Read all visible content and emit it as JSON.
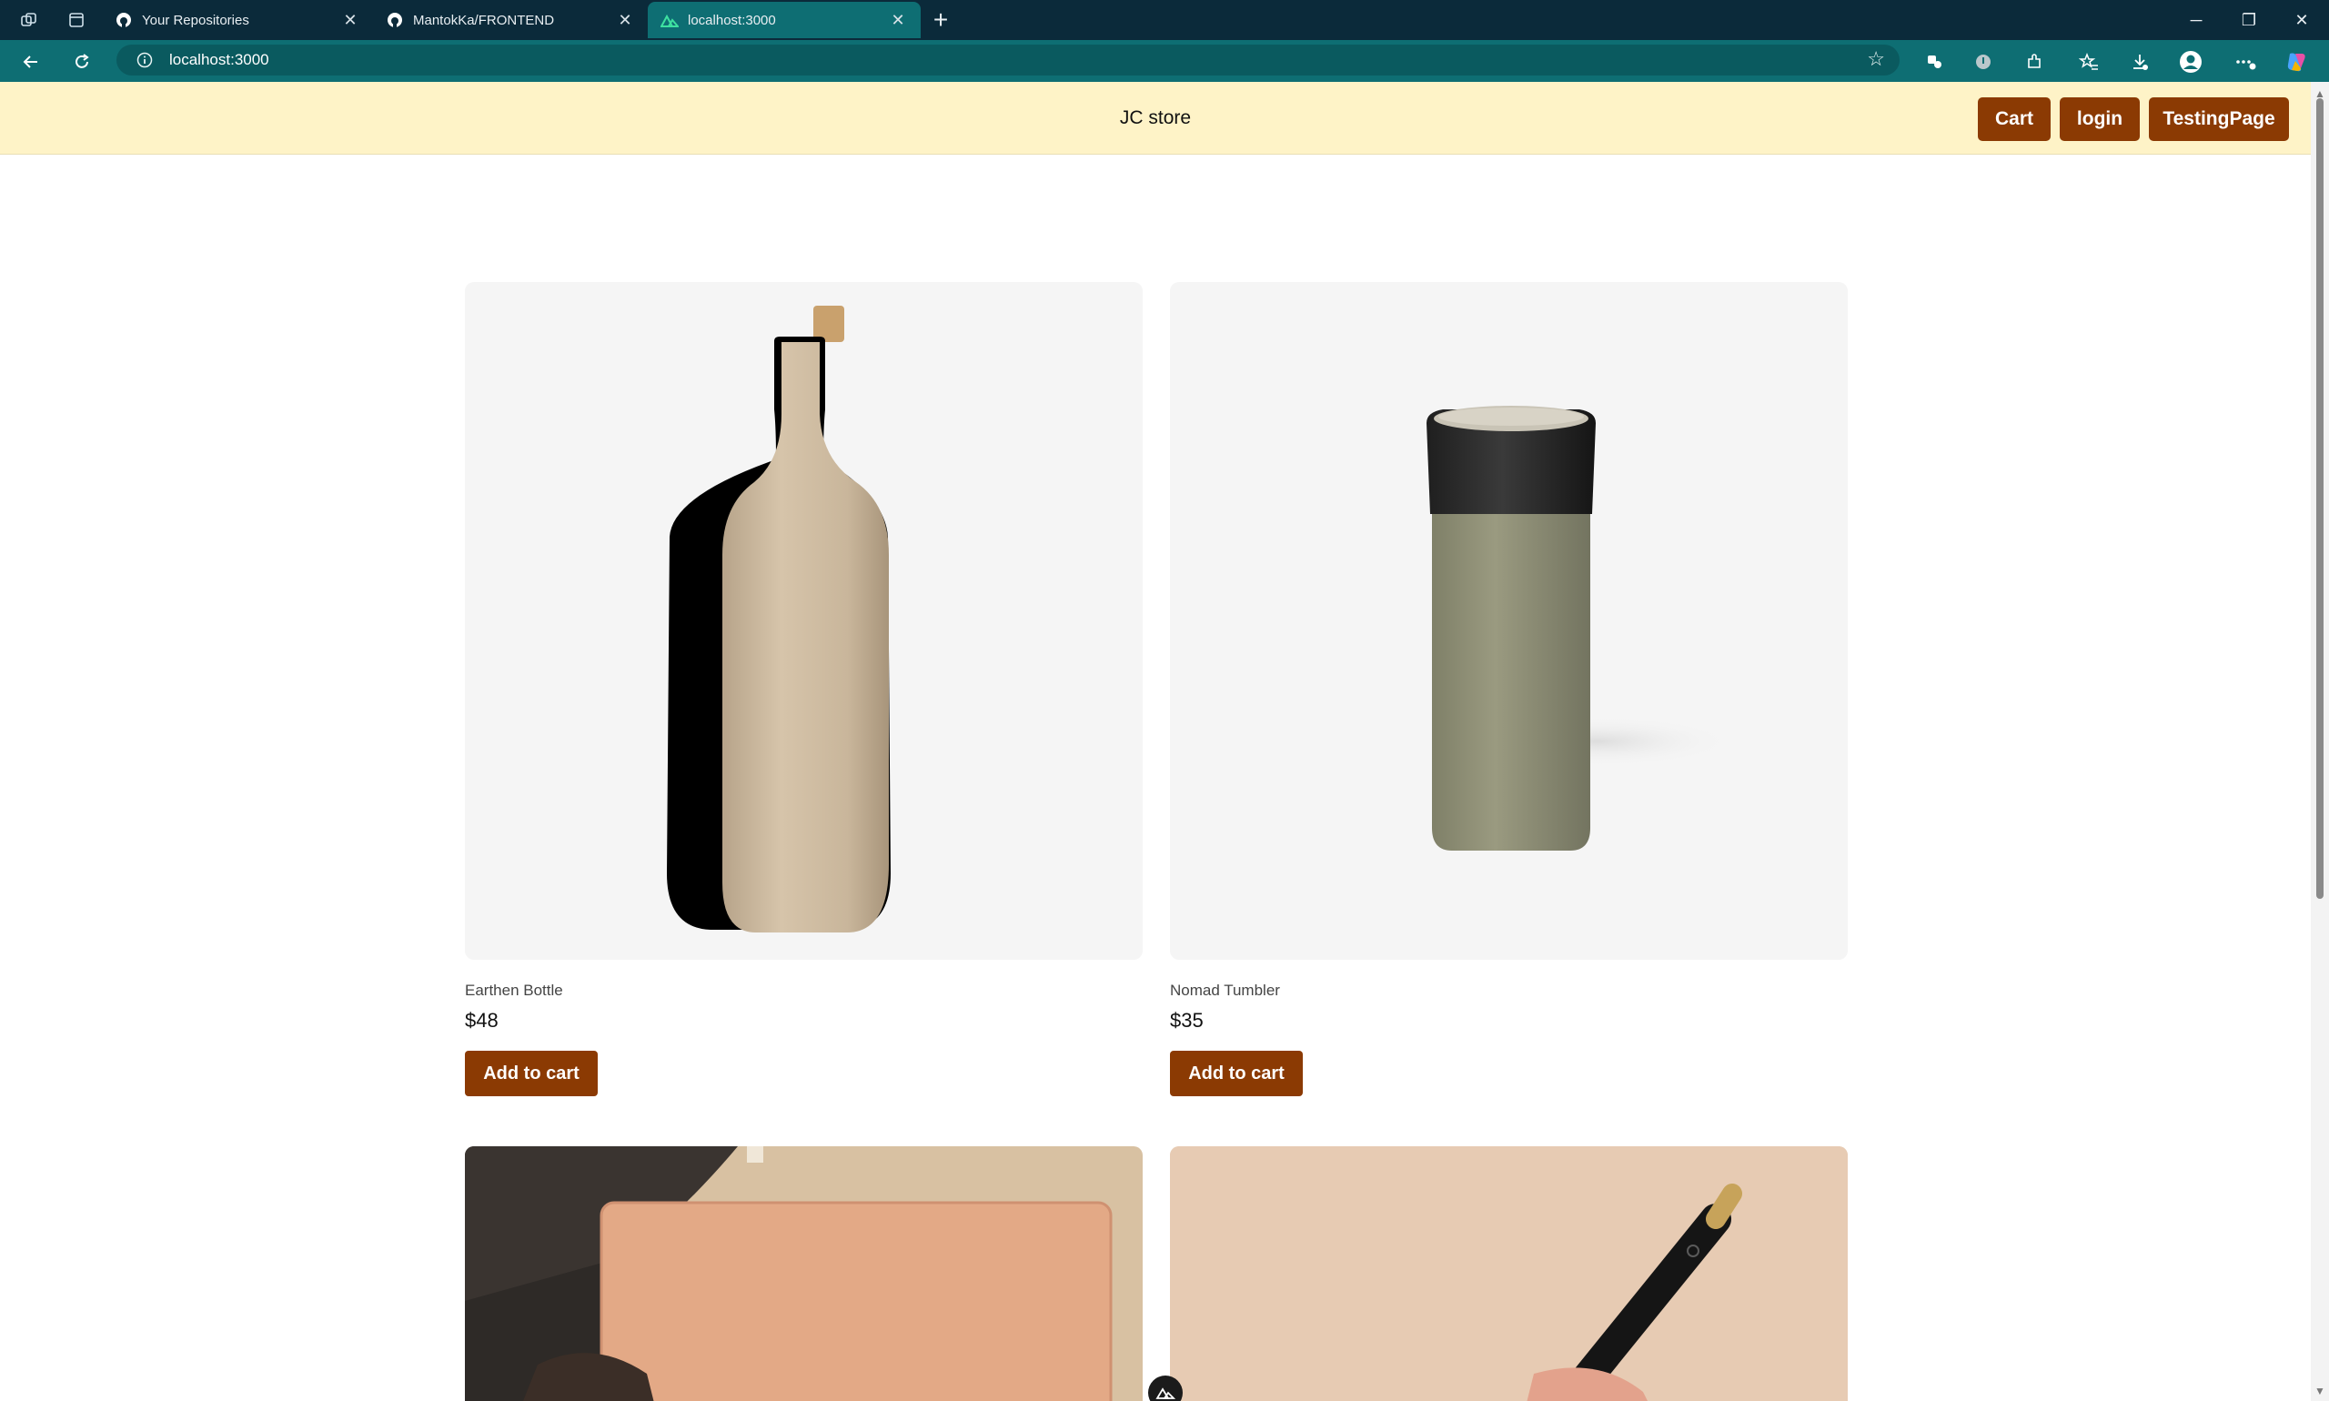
{
  "browser": {
    "tabs": [
      {
        "title": "Your Repositories",
        "icon": "github-icon",
        "active": false
      },
      {
        "title": "MantokKa/FRONTEND",
        "icon": "github-icon",
        "active": false
      },
      {
        "title": "localhost:3000",
        "icon": "nuxt-icon",
        "active": true
      }
    ],
    "address": "localhost:3000"
  },
  "header": {
    "brand": "JC store",
    "buttons": {
      "cart": "Cart",
      "login": "login",
      "testing": "TestingPage"
    }
  },
  "products": [
    {
      "name": "Earthen Bottle",
      "price": "$48",
      "button": "Add to cart"
    },
    {
      "name": "Nomad Tumbler",
      "price": "$35",
      "button": "Add to cart"
    }
  ],
  "colors": {
    "accent": "#8b3a03",
    "header_bg": "#fef3c7",
    "chrome": "#0e6e73"
  }
}
